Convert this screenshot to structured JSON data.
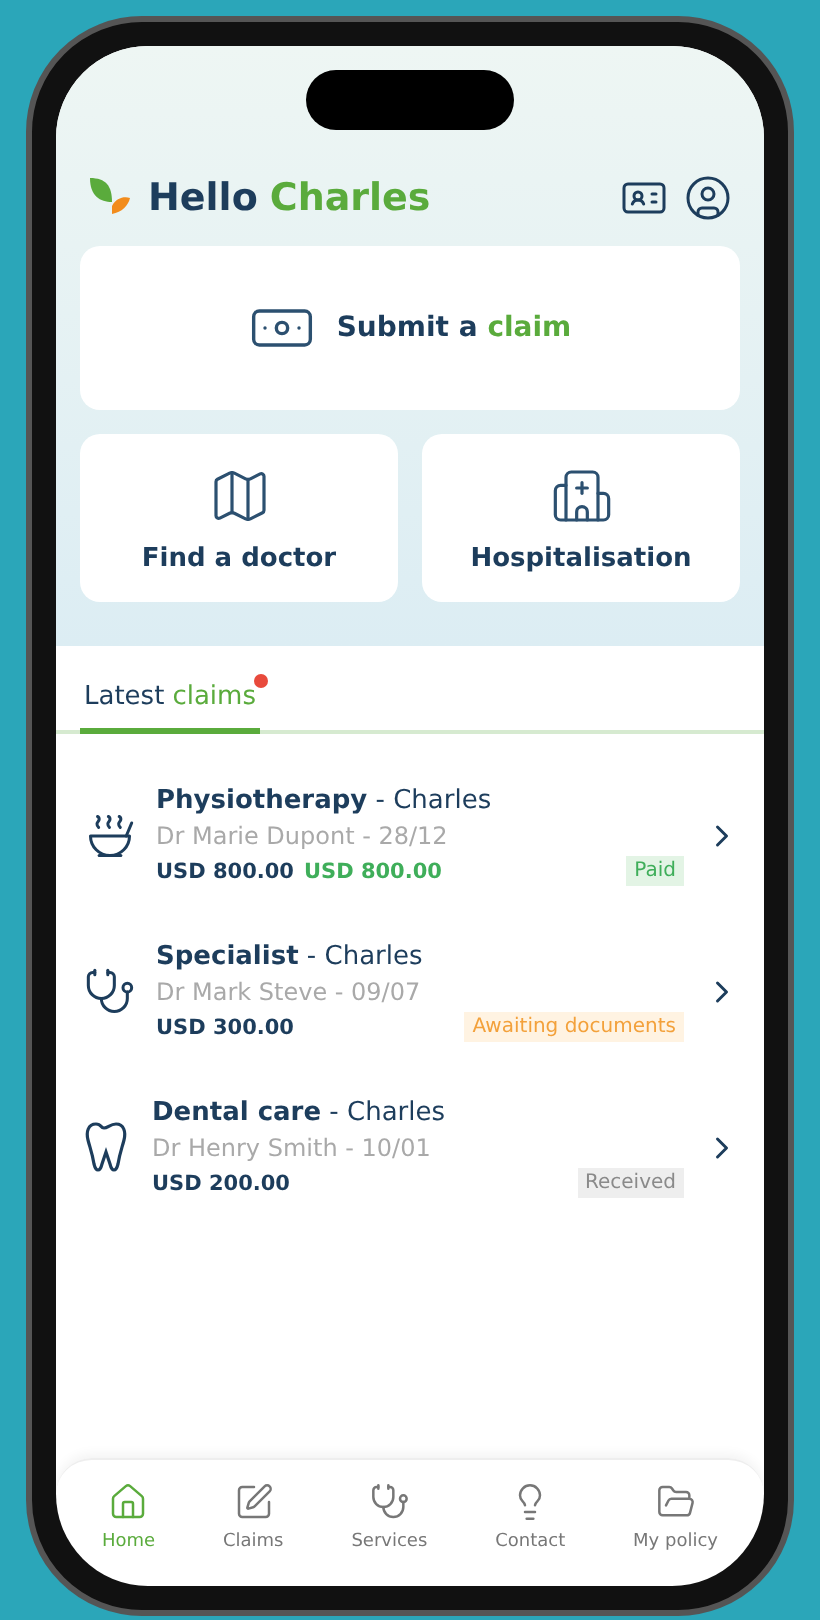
{
  "header": {
    "greeting": "Hello",
    "name": "Charles"
  },
  "actions": {
    "primary": {
      "label": "Submit a",
      "highlight": "claim"
    },
    "secondary": [
      {
        "label": "Find a doctor",
        "kind": "map"
      },
      {
        "label": "Hospitalisation",
        "kind": "hospital"
      }
    ]
  },
  "tabs": [
    {
      "label": "Latest",
      "highlight": "claims",
      "selected": true,
      "unread": true
    }
  ],
  "claims": [
    {
      "title": "**Physiotherapy** - Charles",
      "doctor": "Dr Marie Dupont - 28/12",
      "amount": "USD 800.00",
      "reimbursed": "USD 800.00",
      "status": "Paid",
      "kind": "paid"
    },
    {
      "title": "**Specialist** - Charles",
      "doctor": "Dr Mark Steve - 09/07",
      "amount": "USD 300.00",
      "status": "Awaiting documents",
      "kind": "awaiting"
    },
    {
      "title": "**Dental care** - Charles",
      "doctor": "Dr Henry Smith - 10/01",
      "amount": "USD 200.00",
      "status": "Received",
      "kind": "received"
    }
  ],
  "nav": [
    {
      "label": "Home",
      "selected": true
    },
    {
      "label": "Claims",
      "selected": false
    },
    {
      "label": "Services",
      "selected": false
    },
    {
      "label": "Contact",
      "selected": false
    },
    {
      "label": "My policy",
      "selected": false
    }
  ]
}
